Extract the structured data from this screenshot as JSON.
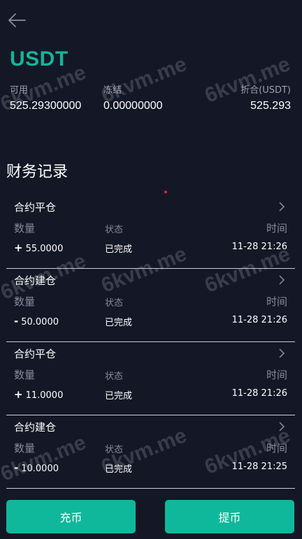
{
  "header": {
    "back_icon": "arrow-left-icon"
  },
  "asset": {
    "symbol": "USDT"
  },
  "balances": {
    "available_label": "可用",
    "available_value": "525.29300000",
    "frozen_label": "冻结",
    "frozen_value": "0.00000000",
    "converted_label": "折合(USDT)",
    "converted_value": "525.293"
  },
  "records_title": "财务记录",
  "records": [
    {
      "title": "合约平仓",
      "qty_label": "数量",
      "status_label": "状态",
      "time_label": "时间",
      "sign": "+",
      "amount": "55.0000",
      "status": "已完成",
      "time": "11-28 21:26"
    },
    {
      "title": "合约建仓",
      "qty_label": "数量",
      "status_label": "状态",
      "time_label": "时间",
      "sign": "-",
      "amount": "50.0000",
      "status": "已完成",
      "time": "11-28 21:26"
    },
    {
      "title": "合约平仓",
      "qty_label": "数量",
      "status_label": "状态",
      "time_label": "时间",
      "sign": "+",
      "amount": "11.0000",
      "status": "已完成",
      "time": "11-28 21:26"
    },
    {
      "title": "合约建仓",
      "qty_label": "数量",
      "status_label": "状态",
      "time_label": "时间",
      "sign": "-",
      "amount": "10.0000",
      "status": "已完成",
      "time": "11-28 21:25"
    }
  ],
  "footer": {
    "deposit_label": "充币",
    "withdraw_label": "提币"
  },
  "watermark": "6kvm.me",
  "colors": {
    "accent": "#0fb89b",
    "background": "#141826"
  }
}
